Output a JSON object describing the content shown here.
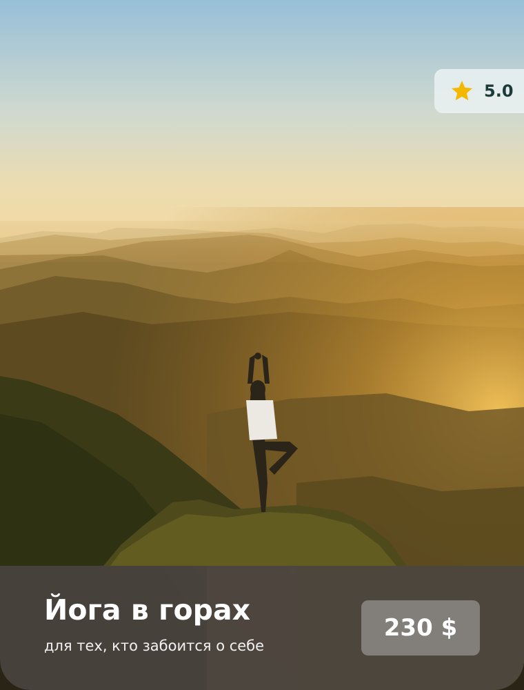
{
  "card": {
    "rating": {
      "value": "5.0",
      "icon": "star-icon",
      "icon_color": "#F5B800"
    },
    "title": "Йога в горах",
    "subtitle": "для тех, кто забоится о себе",
    "price": "230 $"
  },
  "colors": {
    "sky_top": "#97BFD8",
    "sky_horizon": "#F4D9A0",
    "mountains_dark": "#3E3A18",
    "glow": "#F1B43C",
    "panel": "#4B4642",
    "badge_text": "#1D3A3A"
  }
}
